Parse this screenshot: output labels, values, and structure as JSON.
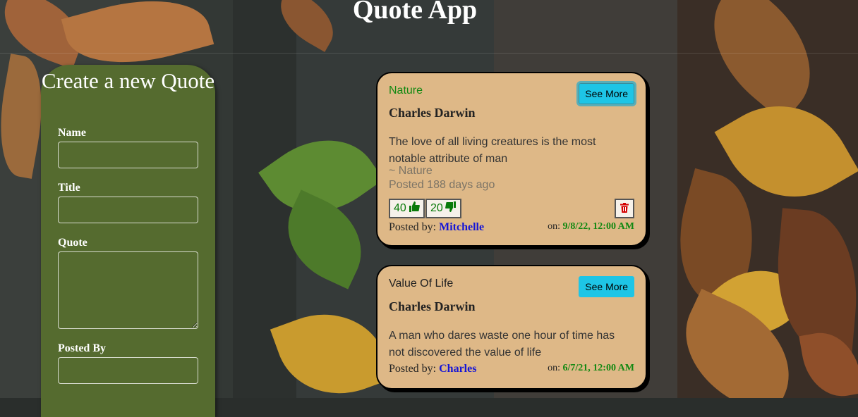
{
  "app": {
    "title": "Quote App"
  },
  "form": {
    "heading": "Create a new Quote",
    "fields": {
      "name": {
        "label": "Name",
        "value": ""
      },
      "title": {
        "label": "Title",
        "value": ""
      },
      "quote": {
        "label": "Quote",
        "value": ""
      },
      "posted_by": {
        "label": "Posted By",
        "value": ""
      }
    }
  },
  "quotes": [
    {
      "category": "Nature",
      "category_color": "#118811",
      "see_more_label": "See More",
      "author": "Charles Darwin",
      "text": "The love of all living creatures is the most notable attribute of man",
      "tag": "~ Nature",
      "age": "Posted 188 days ago",
      "upvotes": "40",
      "downvotes": "20",
      "posted_by_label": "Posted by:",
      "posted_by": "Mitchelle",
      "on_label": "on:",
      "date": "9/8/22, 12:00 AM"
    },
    {
      "category": "Value Of Life",
      "category_color": "#222222",
      "see_more_label": "See More",
      "author": "Charles Darwin",
      "text": "A man who dares waste one hour of time has not discovered the value of life",
      "posted_by_label": "Posted by:",
      "posted_by": "Charles",
      "on_label": "on:",
      "date": "6/7/21, 12:00 AM"
    }
  ],
  "icons": {
    "upvote": "thumbs-up-icon",
    "downvote": "thumbs-down-icon",
    "delete": "trash-icon"
  },
  "colors": {
    "form_bg": "#556b2f",
    "card_bg": "#deb887",
    "button_bg": "#1ec5e6",
    "vote_green": "#0a7a0a",
    "delete_red": "#d40000",
    "user_link": "#1515d6"
  }
}
